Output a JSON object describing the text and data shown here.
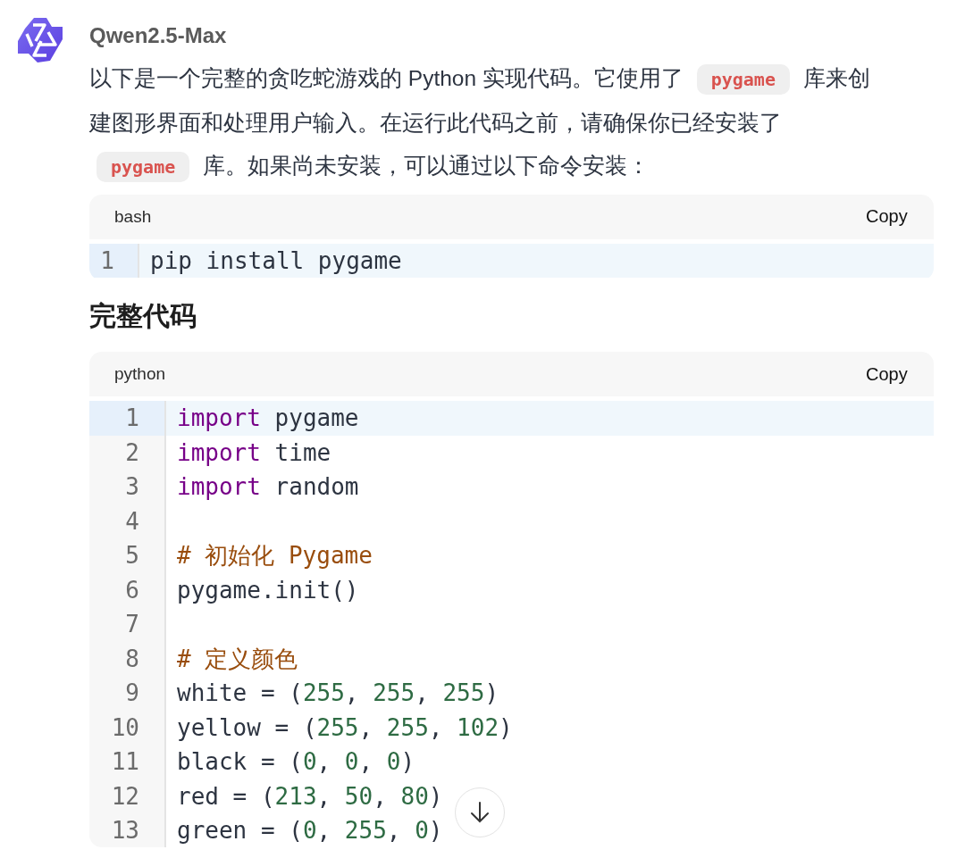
{
  "message": {
    "author": "Qwen2.5-Max",
    "paragraph": [
      {
        "kind": "text",
        "text": "以下是一个完整的贪吃蛇游戏的 Python 实现代码。它使用了 "
      },
      {
        "kind": "code",
        "text": "pygame"
      },
      {
        "kind": "text",
        "text": " 库来创建图形界面和处理用户输入。在运行此代码之前，请确保你已经安装了 "
      },
      {
        "kind": "code",
        "text": "pygame"
      },
      {
        "kind": "text",
        "text": " 库。如果尚未安装，可以通过以下命令安装："
      }
    ],
    "blocks": [
      {
        "kind": "code",
        "language": "bash",
        "copy": "Copy",
        "lines": [
          {
            "number": "1",
            "selected": true,
            "tokens": [
              {
                "kind": "plain",
                "text": "pip install pygame"
              }
            ]
          }
        ]
      },
      {
        "kind": "heading",
        "text": "完整代码"
      },
      {
        "kind": "code",
        "language": "python",
        "copy": "Copy",
        "lines": [
          {
            "number": "1",
            "selected": true,
            "tokens": [
              {
                "kind": "keyword",
                "text": "import"
              },
              {
                "kind": "plain",
                "text": " pygame"
              }
            ]
          },
          {
            "number": "2",
            "selected": false,
            "tokens": [
              {
                "kind": "keyword",
                "text": "import"
              },
              {
                "kind": "plain",
                "text": " time"
              }
            ]
          },
          {
            "number": "3",
            "selected": false,
            "tokens": [
              {
                "kind": "keyword",
                "text": "import"
              },
              {
                "kind": "plain",
                "text": " random"
              }
            ]
          },
          {
            "number": "4",
            "selected": false
          },
          {
            "number": "5",
            "selected": false,
            "tokens": [
              {
                "kind": "comment",
                "text": "# 初始化 Pygame"
              }
            ]
          },
          {
            "number": "6",
            "selected": false,
            "tokens": [
              {
                "kind": "plain",
                "text": "pygame.init()"
              }
            ]
          },
          {
            "number": "7",
            "selected": false
          },
          {
            "number": "8",
            "selected": false,
            "tokens": [
              {
                "kind": "comment",
                "text": "# 定义颜色"
              }
            ]
          },
          {
            "number": "9",
            "selected": false,
            "tokens": [
              {
                "kind": "plain",
                "text": "white = ("
              },
              {
                "kind": "number",
                "text": "255"
              },
              {
                "kind": "plain",
                "text": ", "
              },
              {
                "kind": "number",
                "text": "255"
              },
              {
                "kind": "plain",
                "text": ", "
              },
              {
                "kind": "number",
                "text": "255"
              },
              {
                "kind": "plain",
                "text": ")"
              }
            ]
          },
          {
            "number": "10",
            "selected": false,
            "tokens": [
              {
                "kind": "plain",
                "text": "yellow = ("
              },
              {
                "kind": "number",
                "text": "255"
              },
              {
                "kind": "plain",
                "text": ", "
              },
              {
                "kind": "number",
                "text": "255"
              },
              {
                "kind": "plain",
                "text": ", "
              },
              {
                "kind": "number",
                "text": "102"
              },
              {
                "kind": "plain",
                "text": ")"
              }
            ]
          },
          {
            "number": "11",
            "selected": false,
            "tokens": [
              {
                "kind": "plain",
                "text": "black = ("
              },
              {
                "kind": "number",
                "text": "0"
              },
              {
                "kind": "plain",
                "text": ", "
              },
              {
                "kind": "number",
                "text": "0"
              },
              {
                "kind": "plain",
                "text": ", "
              },
              {
                "kind": "number",
                "text": "0"
              },
              {
                "kind": "plain",
                "text": ")"
              }
            ]
          },
          {
            "number": "12",
            "selected": false,
            "tokens": [
              {
                "kind": "plain",
                "text": "red = ("
              },
              {
                "kind": "number",
                "text": "213"
              },
              {
                "kind": "plain",
                "text": ", "
              },
              {
                "kind": "number",
                "text": "50"
              },
              {
                "kind": "plain",
                "text": ", "
              },
              {
                "kind": "number",
                "text": "80"
              },
              {
                "kind": "plain",
                "text": ")"
              }
            ]
          },
          {
            "number": "13",
            "selected": false,
            "tokens": [
              {
                "kind": "plain",
                "text": "green = ("
              },
              {
                "kind": "number",
                "text": "0"
              },
              {
                "kind": "plain",
                "text": ", "
              },
              {
                "kind": "number",
                "text": "255"
              },
              {
                "kind": "plain",
                "text": ", "
              },
              {
                "kind": "number",
                "text": "0"
              },
              {
                "kind": "plain",
                "text": ")"
              }
            ]
          }
        ]
      }
    ]
  }
}
